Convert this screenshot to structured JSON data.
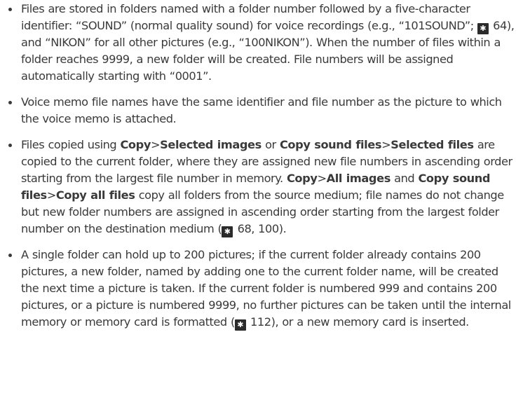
{
  "reference_icon_glyph": "✱",
  "bullets": [
    {
      "s1": "Files are stored in folders named with a folder number followed by a five-character identifier: “SOUND” (normal quality sound) for voice recordings (e.g., “101SOUND”;",
      "ref1": "64",
      "s2": "), and “NIKON” for all other pictures (e.g., “100NIKON”). When the number of files within a folder reaches 9999, a new folder will be created. File numbers will be assigned automatically starting with “0001”."
    },
    {
      "s1": "Voice memo file names have the same identifier and file number as the picture to which the voice memo is attached."
    },
    {
      "b1": "Copy",
      "sep1": ">",
      "b2": "Selected images",
      "t1": "Files copied using",
      "t2": "or",
      "b3": "Copy sound files",
      "sep2": ">",
      "b4": "Selected files",
      "t3": "are copied to the current folder, where they are assigned new file numbers in ascending order starting from the largest file number in memory.",
      "b5": "Copy",
      "sep3": ">",
      "b6": "All images",
      "t4": "and",
      "b7": "Copy sound files",
      "sep4": ">",
      "b8": "Copy all files",
      "t5": "copy all folders from the source medium; file names do not change but new folder numbers are assigned in ascending order starting from the largest folder number on the destination medium (",
      "ref1": "68, 100",
      "t6": ")."
    },
    {
      "s1": "A single folder can hold up to 200 pictures; if the current folder already contains 200 pictures, a new folder, named by adding one to the current folder name, will be created the next time a picture is taken. If the current folder is numbered 999 and contains 200 pictures, or a picture is numbered 9999, no further pictures can be taken until the internal memory or memory card is formatted (",
      "ref1": "112",
      "s2": "), or a new memory card is inserted."
    }
  ]
}
